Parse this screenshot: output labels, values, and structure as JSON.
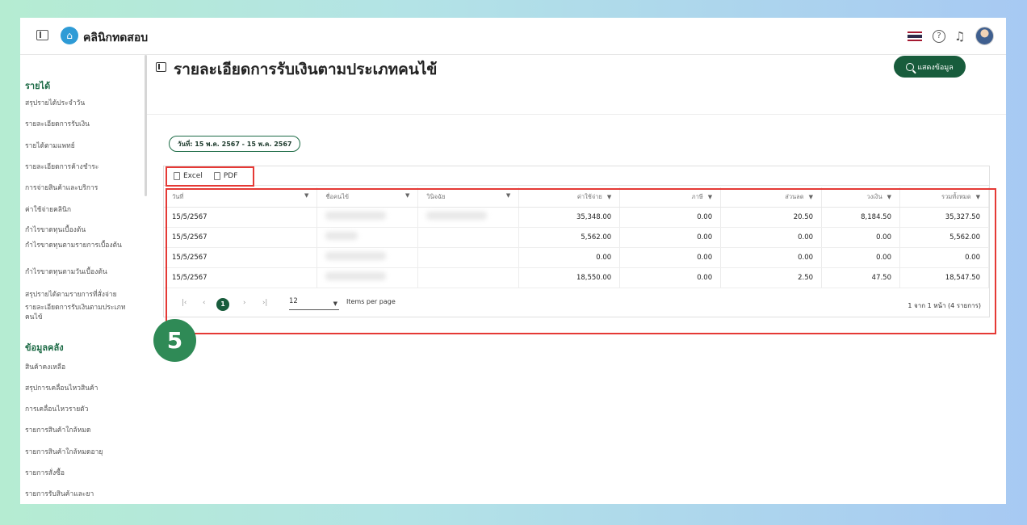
{
  "topbar": {
    "brand": "คลินิกทดสอบ"
  },
  "sidebar": {
    "sections": [
      {
        "title": "รายได้",
        "items": [
          "สรุปรายได้ประจำวัน",
          "รายละเอียดการรับเงิน",
          "รายได้ตามแพทย์",
          "รายละเอียดการค้างชำระ",
          "การจ่ายสินค้าและบริการ",
          "ค่าใช้จ่ายคลินิก",
          "กำไรขาดทุนเบื้องต้น",
          "กำไรขาดทุนตามรายการเบื้องต้น",
          "กำไรขาดทุนตามวันเบื้องต้น",
          "สรุปรายได้ตามรายการที่สั่งจ่าย",
          "รายละเอียดการรับเงินตามประเภทคนไข้"
        ]
      },
      {
        "title": "ข้อมูลคลัง",
        "items": [
          "สินค้าคงเหลือ",
          "สรุปการเคลื่อนไหวสินค้า",
          "การเคลื่อนไหวรายตัว",
          "รายการสินค้าใกล้หมด",
          "รายการสินค้าใกล้หมดอายุ",
          "รายการสั่งซื้อ",
          "รายการรับสินค้าและยา"
        ]
      }
    ]
  },
  "main": {
    "title": "รายละเอียดการรับเงินตามประเภทคนไข้",
    "show_button": "แสดงข้อมูล",
    "date_chip": "วันที่: 15 พ.ค. 2567 - 15 พ.ค. 2567",
    "export_excel": "Excel",
    "export_pdf": "PDF",
    "step_number": "5"
  },
  "table": {
    "headers": [
      "วันที่",
      "ชื่อคนไข้",
      "วินิจฉัย",
      "ค่าใช้จ่าย",
      "ภาษี",
      "ส่วนลด",
      "วงเงิน",
      "รวมทั้งหมด"
    ],
    "rows": [
      [
        "15/5/2567",
        "",
        "",
        "35,348.00",
        "0.00",
        "20.50",
        "8,184.50",
        "35,327.50"
      ],
      [
        "15/5/2567",
        "",
        "",
        "5,562.00",
        "0.00",
        "0.00",
        "0.00",
        "5,562.00"
      ],
      [
        "15/5/2567",
        "",
        "",
        "0.00",
        "0.00",
        "0.00",
        "0.00",
        "0.00"
      ],
      [
        "15/5/2567",
        "",
        "",
        "18,550.00",
        "0.00",
        "2.50",
        "47.50",
        "18,547.50"
      ]
    ]
  },
  "pager": {
    "current_page": "1",
    "items_per_page": "12",
    "items_per_page_label": "Items per page",
    "range_text": "1 จาก 1 หน้า (4 รายการ)"
  },
  "colors": {
    "accent": "#185c3c",
    "highlight": "#e53935",
    "badge": "#2f8a56"
  }
}
